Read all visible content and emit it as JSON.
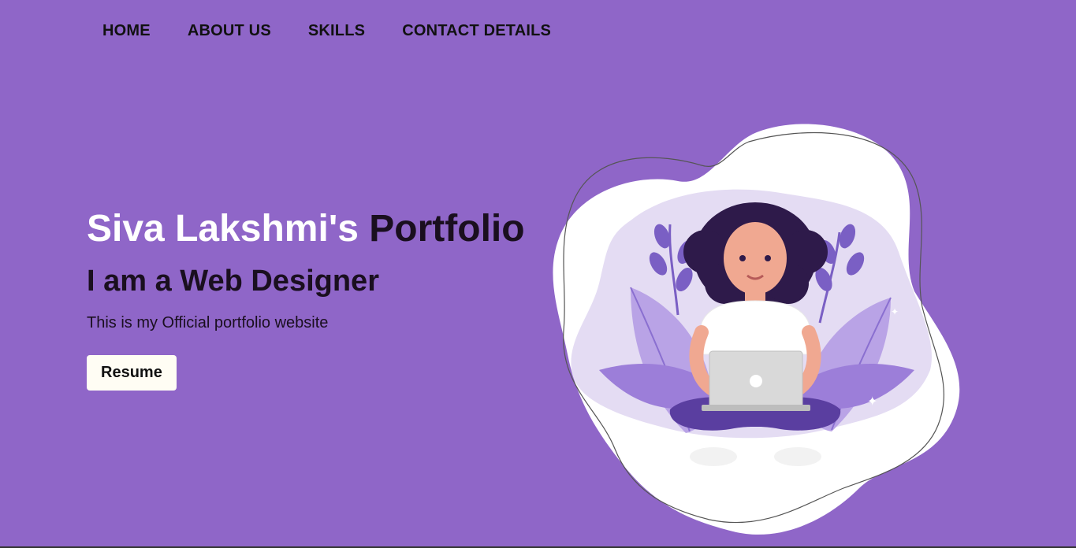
{
  "nav": {
    "items": [
      {
        "label": "HOME"
      },
      {
        "label": "ABOUT US"
      },
      {
        "label": "SKILLS"
      },
      {
        "label": "CONTACT DETAILS"
      }
    ]
  },
  "hero": {
    "title_name": "Siva Lakshmi's",
    "title_word": "Portfolio",
    "subtitle": "I am a Web Designer",
    "description": "This is my Official portfolio website",
    "resume_label": "Resume"
  },
  "colors": {
    "background": "#8f66c8",
    "button_bg": "#fffdf4",
    "title_accent": "#ffffff",
    "text_dark": "#1a0f1f"
  },
  "illustration": {
    "icon": "woman-with-laptop-illustration"
  }
}
